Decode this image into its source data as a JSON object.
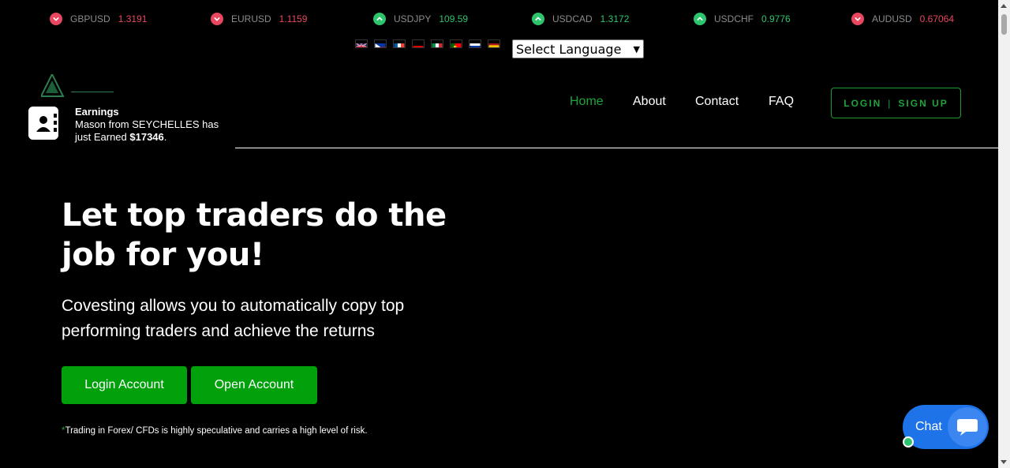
{
  "ticker": [
    {
      "symbol": "GBPUSD",
      "price": "1.3191",
      "direction": "down"
    },
    {
      "symbol": "EURUSD",
      "price": "1.1159",
      "direction": "down"
    },
    {
      "symbol": "USDJPY",
      "price": "109.59",
      "direction": "up"
    },
    {
      "symbol": "USDCAD",
      "price": "1.3172",
      "direction": "up"
    },
    {
      "symbol": "USDCHF",
      "price": "0.9776",
      "direction": "up"
    },
    {
      "symbol": "AUDUSD",
      "price": "0.67064",
      "direction": "down"
    }
  ],
  "language": {
    "flags": [
      "english-flag-icon",
      "filipino-flag-icon",
      "french-flag-icon",
      "german-flag-icon",
      "italian-flag-icon",
      "portuguese-flag-icon",
      "russian-flag-icon",
      "spanish-flag-icon"
    ],
    "select_label": "Select Language"
  },
  "nav": {
    "home": "Home",
    "about": "About",
    "contact": "Contact",
    "faq": "FAQ",
    "login": "LOGIN",
    "separator": "|",
    "signup": "SIGN UP"
  },
  "notification": {
    "title": "Earnings",
    "message": "Mason from SEYCHELLES has just Earned",
    "amount": "$17346",
    "suffix": "."
  },
  "hero": {
    "title_start": "Let top ",
    "title_highlight": "traders",
    "title_end": " do the job for you!",
    "subtitle": "Covesting allows you to automatically copy top performing traders and achieve the returns",
    "login_button": "Login Account",
    "open_button": "Open Account",
    "disclaimer_mark": "*",
    "disclaimer": "Trading in Forex/ CFDs is highly speculative and carries a high level of risk."
  },
  "chat": {
    "label": "Chat"
  },
  "colors": {
    "accent_green": "#00a10b",
    "nav_active": "#1fa33a",
    "price_down": "#e8475f",
    "price_up": "#2ec46e",
    "highlight": "#d6424f",
    "chat_blue": "#1e73e8"
  }
}
